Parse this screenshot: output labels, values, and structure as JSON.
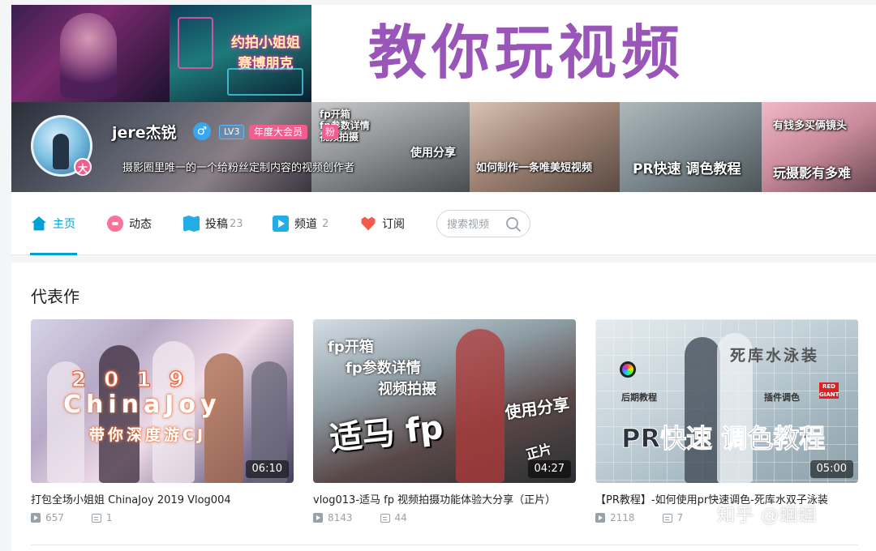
{
  "banner": {
    "title": "教你玩视频",
    "top_label_line1": "约拍小姐姐",
    "top_label_line2": "赛博朋克",
    "strip_fp_line1": "fp开箱",
    "strip_fp_line2": "fp参数详情",
    "strip_fp_line3": "视频拍摄",
    "strip_fp_use": "使用分享",
    "strip_howto": "如何制作一条唯美短视频",
    "strip_pr": "PR快速 调色教程",
    "strip_money_top": "有钱多买俩镜头",
    "strip_money": "玩摄影有多难"
  },
  "profile": {
    "username": "jere杰锐",
    "gender_icon": "male-icon",
    "gender_glyph": "♂",
    "level": "LV3",
    "vip": "年度大会员",
    "fan": "粉",
    "avatar_badge": "大",
    "signature": "摄影圈里唯一的一个给粉丝定制内容的视频创作者"
  },
  "nav": {
    "items": [
      {
        "label": "主页",
        "icon": "home-icon",
        "count": ""
      },
      {
        "label": "动态",
        "icon": "dynamic-icon",
        "count": ""
      },
      {
        "label": "投稿",
        "icon": "upload-icon",
        "count": "23"
      },
      {
        "label": "频道",
        "icon": "channel-icon",
        "count": "2"
      },
      {
        "label": "订阅",
        "icon": "subscribe-icon",
        "count": ""
      }
    ],
    "search_placeholder": "搜索视频",
    "accent": "#00a1d6"
  },
  "works": {
    "section_title": "代表作",
    "cards": [
      {
        "title": "打包全场小姐姐 ChinaJoy 2019 Vlog004",
        "duration": "06:10",
        "plays": "657",
        "danmaku": "1",
        "thumb_year": "2019",
        "thumb_main": "ChinaJoy",
        "thumb_sub": "带你深度游CJ"
      },
      {
        "title": "vlog013-适马 fp 视频拍摄功能体验大分享（正片）",
        "duration": "04:27",
        "plays": "8143",
        "danmaku": "44",
        "thumb_line1": "fp开箱",
        "thumb_line2": "fp参数详情",
        "thumb_line3": "视频拍摄",
        "thumb_main": "适马 fp",
        "thumb_use": "使用分享",
        "thumb_tag": "正片"
      },
      {
        "title": "【PR教程】-如何使用pr快速调色-死库水双子泳装",
        "duration": "05:00",
        "plays": "2118",
        "danmaku": "7",
        "thumb_top": "死库水泳装",
        "thumb_left": "后期教程",
        "thumb_right": "插件调色",
        "thumb_main": "PR快速 调色教程",
        "thumb_red": "RED GIANT"
      }
    ]
  },
  "watermark": "知乎 @蝈蝈"
}
